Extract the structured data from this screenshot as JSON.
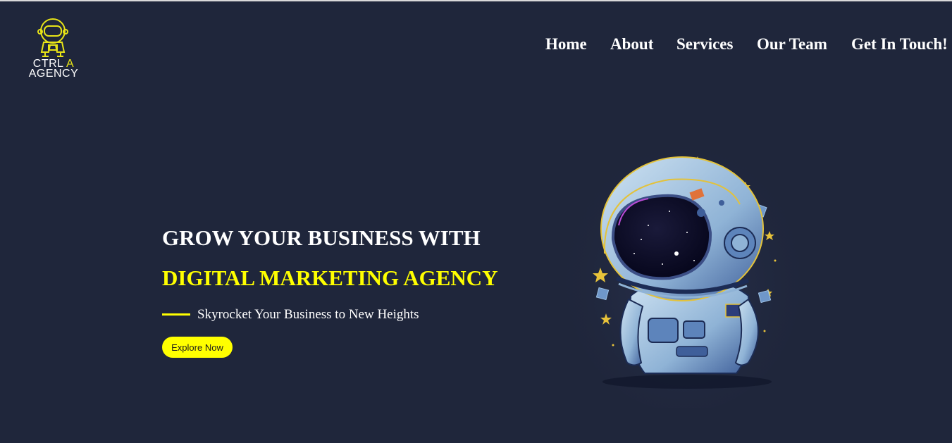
{
  "logo": {
    "line1": "CTRL",
    "line1_accent": "A",
    "line2": "AGENCY",
    "icon": "astronaut-logo-icon"
  },
  "nav": [
    {
      "label": "Home"
    },
    {
      "label": "About"
    },
    {
      "label": "Services"
    },
    {
      "label": "Our Team"
    },
    {
      "label": "Get In Touch!"
    }
  ],
  "hero": {
    "headline_line1": "GROW YOUR BUSINESS WITH",
    "headline_line2": "DIGITAL MARKETING AGENCY",
    "tagline": "Skyrocket Your Business to New Heights",
    "cta_label": "Explore Now",
    "illustration": "astronaut-illustration"
  },
  "colors": {
    "background": "#1f263b",
    "accent": "#ffff00",
    "text": "#ffffff"
  }
}
